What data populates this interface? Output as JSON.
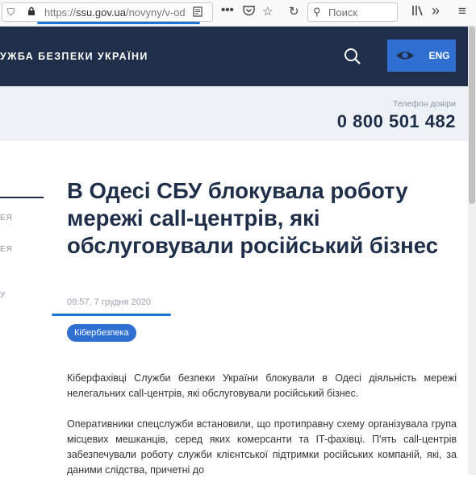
{
  "browser": {
    "url_prefix": "https://",
    "url_main": "ssu.gov.ua",
    "url_path": "/novyny/v-ode",
    "search_placeholder": "Поиск"
  },
  "header": {
    "site_title": "УЖБА БЕЗПЕКИ УКРАЇНИ",
    "lang_button": "ENG"
  },
  "hotline": {
    "label": "Телефон довіри",
    "number": "0 800 501 482"
  },
  "sidebar": {
    "items": [
      "ЕЯ",
      "ЕЯ",
      "У"
    ]
  },
  "article": {
    "title": "В Одесі СБУ блокувала роботу мережі call-центрів, які обслуговували російський бізнес",
    "datetime": "09:57, 7 грудня 2020",
    "tag": "Кібербезпека",
    "paragraphs": [
      "Кіберфахівці Служби безпеки України блокували в Одесі діяльність мережі нелегальних call-центрів, які обслуговували російський бізнес.",
      "Оперативники спецслужби встановили, що протиправну схему організувала група місцевих мешканців, серед яких комерсанти та IT-фахівці. П'ять call-центрів забезпечували роботу служби клієнтської підтримки російських компаній, які, за даними слідства, причетні до"
    ]
  }
}
